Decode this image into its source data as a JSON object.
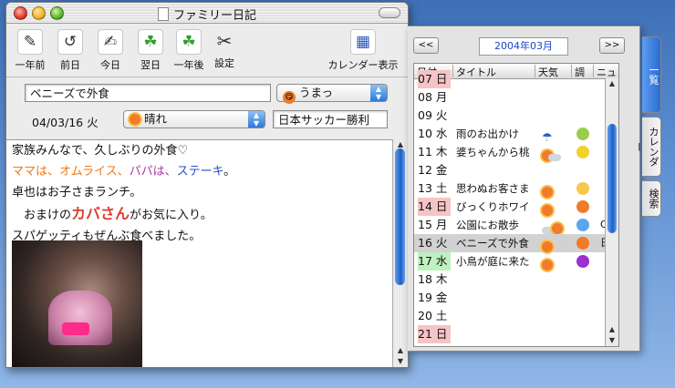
{
  "window": {
    "title": "ファミリー日記"
  },
  "toolbar": [
    {
      "label": "一年前",
      "icon": "quill-back-icon",
      "glyph": "✎"
    },
    {
      "label": "前日",
      "icon": "back-arrow-icon",
      "glyph": "↺"
    },
    {
      "label": "今日",
      "icon": "today-quill-icon",
      "glyph": "✍"
    },
    {
      "label": "翌日",
      "icon": "clover-forward-icon",
      "glyph": "☘"
    },
    {
      "label": "一年後",
      "icon": "clover-year-icon",
      "glyph": "☘"
    },
    {
      "label": "設定",
      "icon": "tools-icon",
      "glyph": "✂"
    },
    {
      "label": "カレンダー表示",
      "icon": "calendar-icon",
      "glyph": "▦"
    }
  ],
  "entry": {
    "title": "ベニーズで外食",
    "mood": "うまっ",
    "date": "04/03/16 火",
    "weather": "晴れ",
    "news": "日本サッカー勝利"
  },
  "body_lines": [
    [
      {
        "t": "家族みんなで、久しぶりの外食♡",
        "c": "#111"
      }
    ],
    [
      {
        "t": "ママは、オムライス、",
        "c": "#ef7a1a"
      },
      {
        "t": "パパは、",
        "c": "#b03aa6"
      },
      {
        "t": "ステーキ",
        "c": "#2c4fc7"
      },
      {
        "t": "。",
        "c": "#111"
      }
    ],
    [
      {
        "t": "卓也はお子さまランチ。",
        "c": "#111"
      }
    ],
    [
      {
        "t": "　おまけの",
        "c": "#111"
      },
      {
        "t": "カバさん",
        "c": "#e23b2e",
        "big": true
      },
      {
        "t": "がお気に入り。",
        "c": "#111"
      }
    ],
    [
      {
        "t": "スパゲッティもぜんぶ食べました。",
        "c": "#111"
      }
    ]
  ],
  "calendar": {
    "prev": "<<",
    "next": ">>",
    "month": "2004年03月",
    "columns": [
      "日付",
      "タイトル",
      "天気",
      "調",
      "ニュ"
    ],
    "rows": [
      {
        "date": "07 日",
        "type": "sun",
        "title": "",
        "weather": "",
        "cond": "",
        "news": ""
      },
      {
        "date": "08 月",
        "type": "",
        "title": "",
        "weather": "",
        "cond": "",
        "news": ""
      },
      {
        "date": "09 火",
        "type": "",
        "title": "",
        "weather": "",
        "cond": "",
        "news": ""
      },
      {
        "date": "10 水",
        "type": "",
        "title": "雨のお出かけ",
        "weather": "umbrella",
        "cond": "sad",
        "news": ""
      },
      {
        "date": "11 木",
        "type": "",
        "title": "婆ちゃんから桃",
        "weather": "sun-cloud",
        "cond": "happy",
        "news": ""
      },
      {
        "date": "12 金",
        "type": "",
        "title": "",
        "weather": "",
        "cond": "",
        "news": ""
      },
      {
        "date": "13 土",
        "type": "",
        "title": "思わぬお客さま",
        "weather": "sun",
        "cond": "surprised",
        "news": ""
      },
      {
        "date": "14 日",
        "type": "sun",
        "title": "びっくりホワイ",
        "weather": "sun",
        "cond": "love",
        "news": ""
      },
      {
        "date": "15 月",
        "type": "",
        "title": "公園にお散歩",
        "weather": "cloud-sun",
        "cond": "blue",
        "news": "Qち"
      },
      {
        "date": "16 火",
        "type": "",
        "title": "ベニーズで外食",
        "weather": "sun",
        "cond": "love",
        "news": "日本",
        "selected": true
      },
      {
        "date": "17 水",
        "type": "hol",
        "title": "小鳥が庭に来た",
        "weather": "sun",
        "cond": "purple",
        "news": ""
      },
      {
        "date": "18 木",
        "type": "",
        "title": "",
        "weather": "",
        "cond": "",
        "news": ""
      },
      {
        "date": "19 金",
        "type": "",
        "title": "",
        "weather": "",
        "cond": "",
        "news": ""
      },
      {
        "date": "20 土",
        "type": "",
        "title": "",
        "weather": "",
        "cond": "",
        "news": ""
      },
      {
        "date": "21 日",
        "type": "sun",
        "title": "",
        "weather": "",
        "cond": "",
        "news": ""
      }
    ]
  },
  "tabs": [
    "一覧",
    "カレンダー",
    "検索"
  ],
  "colors": {
    "accent": "#2a6bd0",
    "sunday": "#f5c4c4",
    "holiday": "#bff0bf",
    "selected": "#d2d2d2"
  }
}
